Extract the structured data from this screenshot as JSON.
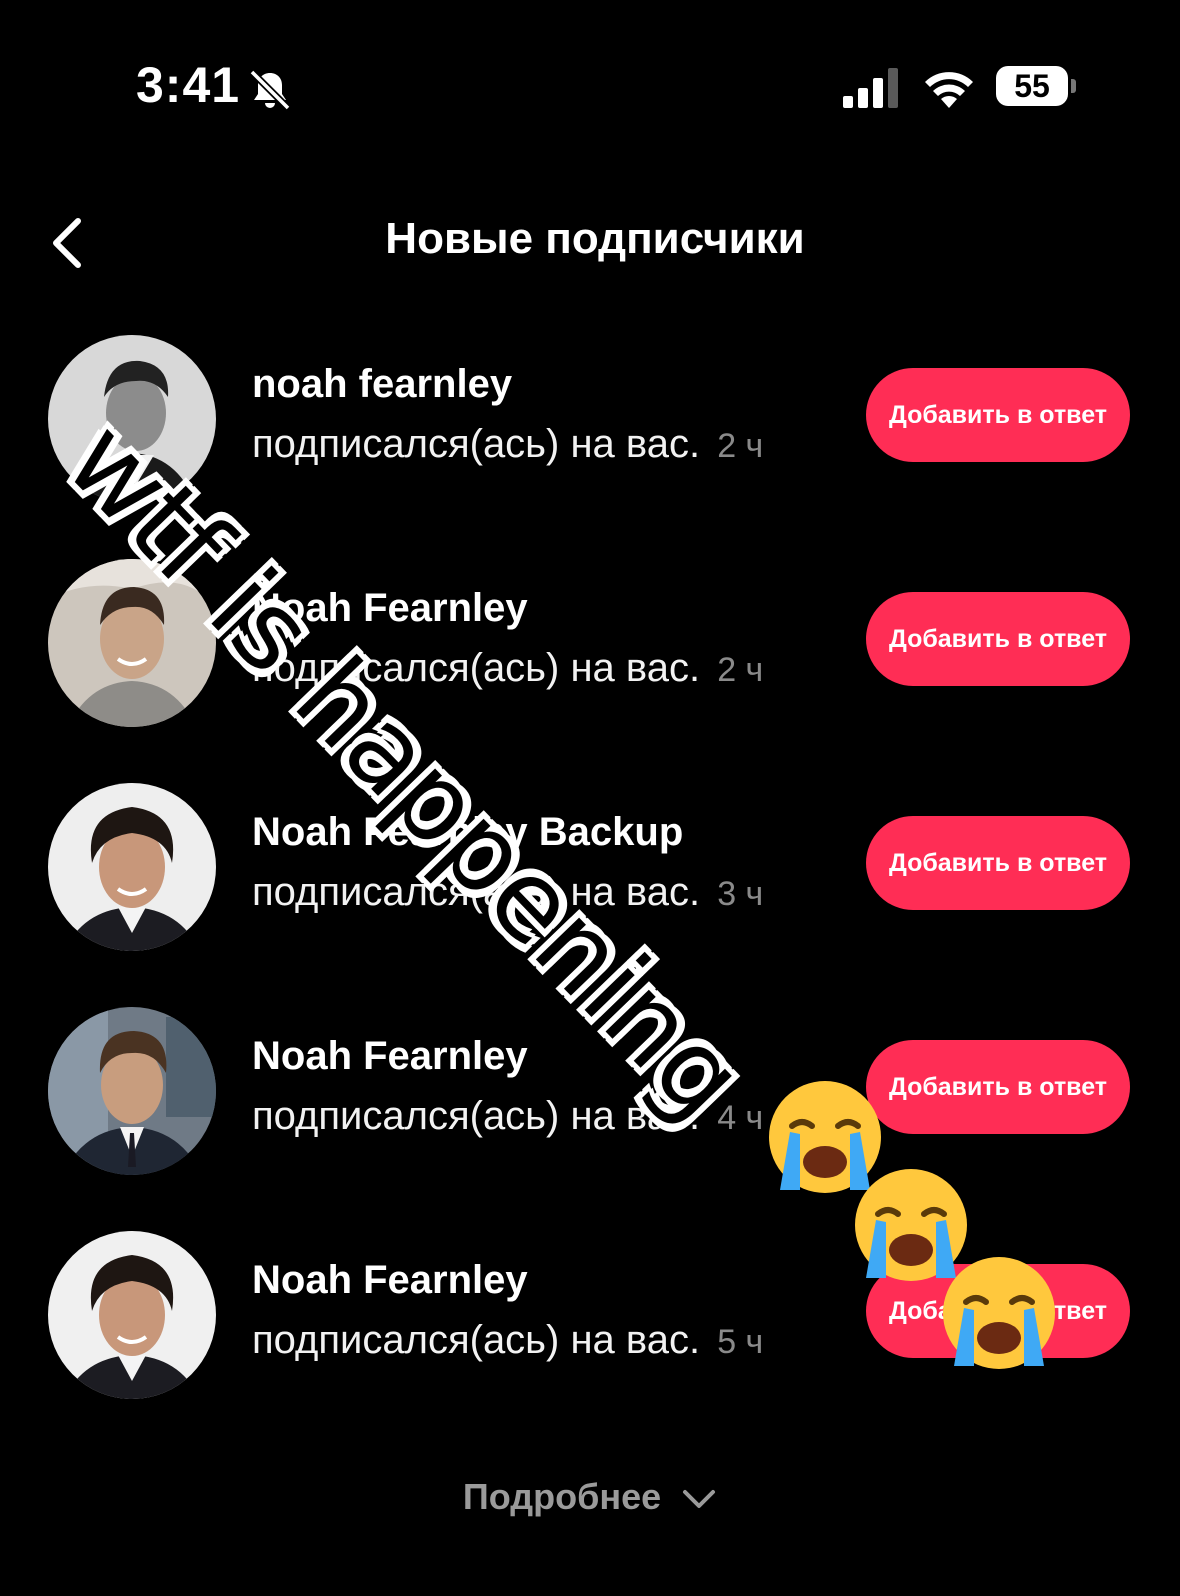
{
  "status_bar": {
    "time": "3:41",
    "battery": "55",
    "icons": [
      "bell-off-icon",
      "signal-icon",
      "wifi-icon",
      "battery-icon"
    ]
  },
  "header": {
    "title": "Новые подписчики",
    "back_icon": "chevron-left-icon"
  },
  "followers": [
    {
      "name": "noah fearnley",
      "action": "подписался(ась) на вас.",
      "time_ago": "2 ч",
      "button": "Добавить в ответ"
    },
    {
      "name": "Noah Fearnley",
      "action": "подписался(ась) на вас.",
      "time_ago": "2 ч",
      "button": "Добавить в ответ"
    },
    {
      "name": "Noah Fearnley Backup",
      "action": "подписался(ась) на вас.",
      "time_ago": "3 ч",
      "button": "Добавить в ответ"
    },
    {
      "name": "Noah Fearnley",
      "action": "подписался(ась) на вас.",
      "time_ago": "4 ч",
      "button": "Добавить в ответ"
    },
    {
      "name": "Noah Fearnley",
      "action": "подписался(ась) на вас.",
      "time_ago": "5 ч",
      "button": "Добавить в ответ"
    }
  ],
  "more": {
    "label": "Подробнее",
    "icon": "chevron-down-icon"
  },
  "overlay": {
    "text": "wtf is happening",
    "emoji": "loudly-crying-face"
  },
  "colors": {
    "background": "#000000",
    "accent": "#ff2d55",
    "muted": "#8a8a8a"
  }
}
